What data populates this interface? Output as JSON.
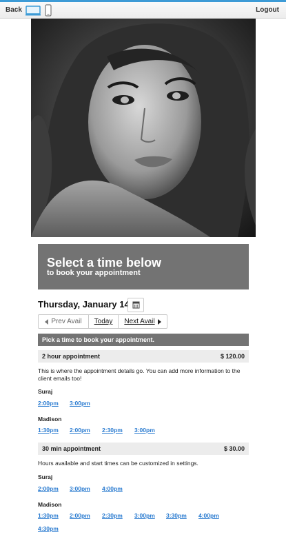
{
  "topbar": {
    "back_label": "Back",
    "logout_label": "Logout",
    "desktop_icon": "desktop-icon",
    "mobile_icon": "mobile-icon"
  },
  "photo": {
    "description": ""
  },
  "banner": {
    "title": "Select a time below",
    "subtitle": "to book your appointment"
  },
  "date_nav": {
    "date": "Thursday, January 14",
    "calendar_icon": "calendar-icon",
    "prev_label": "Prev Avail",
    "today_label": "Today",
    "next_label": "Next Avail"
  },
  "pick_label": "Pick a time to book your appointment.",
  "appointments": [
    {
      "name": "2 hour appointment",
      "price": "$ 120.00",
      "description": "This is where the appointment details go. You can add more information to the client emails too!",
      "staff": [
        {
          "name": "Suraj",
          "times": [
            "2:00pm",
            "3:00pm"
          ]
        },
        {
          "name": "Madison",
          "times": [
            "1:30pm",
            "2:00pm",
            "2:30pm",
            "3:00pm"
          ]
        }
      ]
    },
    {
      "name": "30 min appointment",
      "price": "$ 30.00",
      "description": "Hours available and start times can be customized in settings.",
      "staff": [
        {
          "name": "Suraj",
          "times": [
            "2:00pm",
            "3:00pm",
            "4:00pm"
          ]
        },
        {
          "name": "Madison",
          "times": [
            "1:30pm",
            "2:00pm",
            "2:30pm",
            "3:00pm",
            "3:30pm",
            "4:00pm",
            "4:30pm"
          ]
        }
      ]
    }
  ],
  "colors": {
    "accent": "#3d9bd6",
    "banner": "#737373",
    "link": "#2a7bd0",
    "row_bg": "#ececec"
  }
}
